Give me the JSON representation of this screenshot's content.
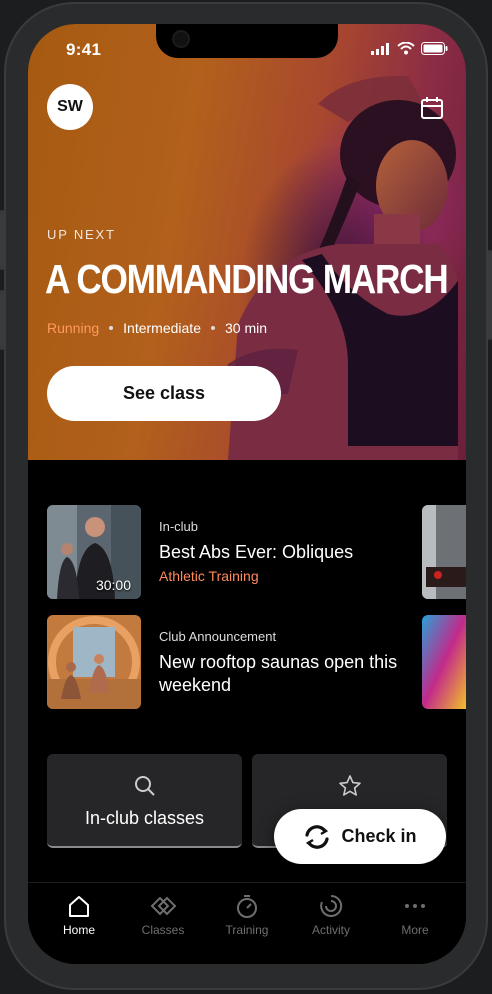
{
  "status_bar": {
    "time": "9:41"
  },
  "header": {
    "avatar_initials": "SW",
    "calendar_icon": "calendar-icon"
  },
  "hero": {
    "eyebrow": "UP NEXT",
    "title": "A COMMANDING MARCH",
    "category": "Running",
    "level": "Intermediate",
    "duration": "30 min",
    "cta": "See class",
    "colors": {
      "category": "#ff9a5c",
      "gradient_start": "#a65a10",
      "gradient_end": "#6a1f3a"
    }
  },
  "feed": [
    {
      "kicker": "In-club",
      "title": "Best Abs Ever: Obliques",
      "category": "Athletic Training",
      "thumb_time": "30:00"
    },
    {
      "kicker": "Club Announcement",
      "title": "New rooftop saunas open this weekend"
    }
  ],
  "tiles": [
    {
      "label": "In-club classes",
      "icon": "search-icon"
    },
    {
      "label": "",
      "icon": "star-icon"
    }
  ],
  "check_in": {
    "label": "Check in",
    "icon": "refresh-icon"
  },
  "tabs": [
    {
      "label": "Home",
      "icon": "home-icon",
      "active": true
    },
    {
      "label": "Classes",
      "icon": "classes-icon",
      "active": false
    },
    {
      "label": "Training",
      "icon": "timer-icon",
      "active": false
    },
    {
      "label": "Activity",
      "icon": "activity-ring-icon",
      "active": false
    },
    {
      "label": "More",
      "icon": "more-icon",
      "active": false
    }
  ]
}
